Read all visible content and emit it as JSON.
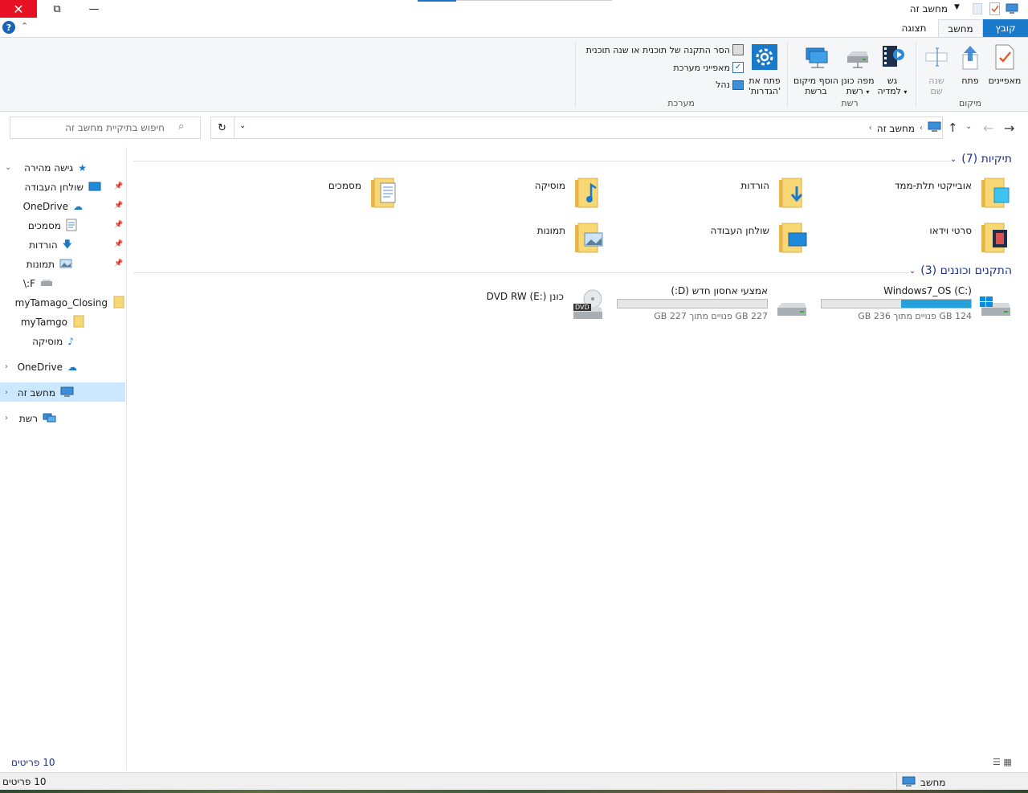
{
  "window": {
    "title": "מחשב זה"
  },
  "ribbon": {
    "tabs": {
      "file": "קובץ",
      "computer": "מחשב",
      "view": "תצוגה"
    },
    "groups": {
      "location": {
        "label": "מיקום",
        "properties": "מאפיינים",
        "open": "פתח",
        "rename_line1": "שנה",
        "rename_line2": "שם"
      },
      "network": {
        "label": "רשת",
        "media_line1": "גש",
        "media_line2": "למדיה",
        "map_drive_line1": "מפה כונן",
        "map_drive_line2": "רשת",
        "add_location_line1": "הוסף מיקום",
        "add_location_line2": "ברשת"
      },
      "system": {
        "label": "מערכת",
        "open_settings_line1": "פתח את",
        "open_settings_line2": "'הגדרות'",
        "uninstall": "הסר התקנה של תוכנית או שנה תוכנית",
        "system_properties": "מאפייני מערכת",
        "manage": "נהל"
      }
    }
  },
  "address": {
    "breadcrumb": [
      "מחשב זה"
    ],
    "search_placeholder": "חיפוש בתיקיית מחשב זה"
  },
  "nav": {
    "quick_access": "גישה מהירה",
    "items": [
      {
        "label": "שולחן העבודה",
        "icon": "desktop-icon",
        "pinned": true
      },
      {
        "label": "OneDrive",
        "icon": "cloud-icon",
        "pinned": true
      },
      {
        "label": "מסמכים",
        "icon": "documents-icon",
        "pinned": true
      },
      {
        "label": "הורדות",
        "icon": "download-icon",
        "pinned": true
      },
      {
        "label": "תמונות",
        "icon": "pictures-icon",
        "pinned": true
      },
      {
        "label": "F:\\",
        "icon": "drive-icon",
        "pinned": false
      },
      {
        "label": "myTamago_Closing",
        "icon": "folder-icon",
        "pinned": false
      },
      {
        "label": "myTamgo",
        "icon": "folder-icon",
        "pinned": false
      },
      {
        "label": "מוסיקה",
        "icon": "music-icon",
        "pinned": false
      }
    ],
    "onedrive": "OneDrive",
    "this_pc": "מחשב זה",
    "network": "רשת"
  },
  "content": {
    "folders_header": "תיקיות (7)",
    "folders": [
      {
        "label": "אובייקטי תלת-ממד",
        "icon": "3d-objects-folder-icon"
      },
      {
        "label": "הורדות",
        "icon": "downloads-folder-icon"
      },
      {
        "label": "מוסיקה",
        "icon": "music-folder-icon"
      },
      {
        "label": "מסמכים",
        "icon": "documents-folder-icon"
      },
      {
        "label": "סרטי וידאו",
        "icon": "videos-folder-icon"
      },
      {
        "label": "שולחן העבודה",
        "icon": "desktop-folder-icon"
      },
      {
        "label": "תמונות",
        "icon": "pictures-folder-icon"
      }
    ],
    "devices_header": "התקנים וכוננים (3)",
    "devices": [
      {
        "label": "Windows7_OS (C:)",
        "free": "124 GB פנויים מתוך 236 GB",
        "used_fraction": 0.47
      },
      {
        "label": "אמצעי אחסון חדש (D:)",
        "free": "227 GB פנויים מתוך 227 GB",
        "used_fraction": 0.0
      },
      {
        "label": "כונן DVD RW (E:)",
        "dvd_badge": "DVD"
      }
    ]
  },
  "status": {
    "items_count": "10 פריטים",
    "bottom_left": "10 פריטים",
    "bottom_right": "מחשב"
  },
  "colors": {
    "accent": "#1979ca",
    "close": "#e81123",
    "drive_fill": "#26a0da",
    "header_text": "#1e3287"
  }
}
